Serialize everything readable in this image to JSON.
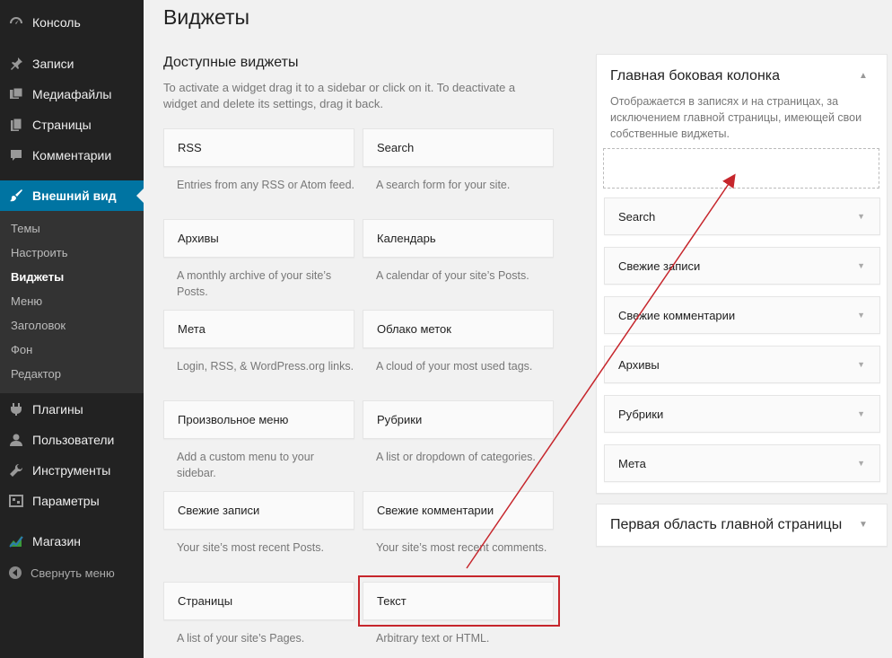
{
  "sidebar": {
    "items": [
      {
        "label": "Консоль",
        "icon": "dashboard-icon"
      },
      {
        "label": "Записи",
        "icon": "pin-icon"
      },
      {
        "label": "Медиафайлы",
        "icon": "media-icon"
      },
      {
        "label": "Страницы",
        "icon": "pages-icon"
      },
      {
        "label": "Комментарии",
        "icon": "comments-icon"
      },
      {
        "label": "Внешний вид",
        "icon": "brush-icon"
      },
      {
        "label": "Плагины",
        "icon": "plugin-icon"
      },
      {
        "label": "Пользователи",
        "icon": "users-icon"
      },
      {
        "label": "Инструменты",
        "icon": "tools-icon"
      },
      {
        "label": "Параметры",
        "icon": "settings-icon"
      },
      {
        "label": "Магазин",
        "icon": "store-icon"
      }
    ],
    "submenu": [
      "Темы",
      "Настроить",
      "Виджеты",
      "Меню",
      "Заголовок",
      "Фон",
      "Редактор"
    ],
    "collapse_label": "Свернуть меню"
  },
  "page": {
    "title": "Виджеты",
    "available_title": "Доступные виджеты",
    "available_desc": "To activate a widget drag it to a sidebar or click on it. To deactivate a widget and delete its settings, drag it back."
  },
  "widgets": [
    {
      "name": "RSS",
      "desc": "Entries from any RSS or Atom feed."
    },
    {
      "name": "Search",
      "desc": "A search form for your site."
    },
    {
      "name": "Архивы",
      "desc": "A monthly archive of your site’s Posts."
    },
    {
      "name": "Календарь",
      "desc": "A calendar of your site’s Posts."
    },
    {
      "name": "Мета",
      "desc": "Login, RSS, & WordPress.org links."
    },
    {
      "name": "Облако меток",
      "desc": "A cloud of your most used tags."
    },
    {
      "name": "Произвольное меню",
      "desc": "Add a custom menu to your sidebar."
    },
    {
      "name": "Рубрики",
      "desc": "A list or dropdown of categories."
    },
    {
      "name": "Свежие записи",
      "desc": "Your site’s most recent Posts."
    },
    {
      "name": "Свежие комментарии",
      "desc": "Your site’s most recent comments."
    },
    {
      "name": "Страницы",
      "desc": "A list of your site’s Pages."
    },
    {
      "name": "Текст",
      "desc": "Arbitrary text or HTML."
    }
  ],
  "main_sidebar": {
    "title": "Главная боковая колонка",
    "desc": "Отображается в записях и на страницах, за исключением главной страницы, имеющей свои собственные виджеты.",
    "widgets": [
      "Search",
      "Свежие записи",
      "Свежие комментарии",
      "Архивы",
      "Рубрики",
      "Мета"
    ]
  },
  "front_area": {
    "title": "Первая область главной страницы"
  },
  "colors": {
    "admin_bar": "#222222",
    "active_menu": "#0074a2",
    "highlight": "#c6262c"
  }
}
